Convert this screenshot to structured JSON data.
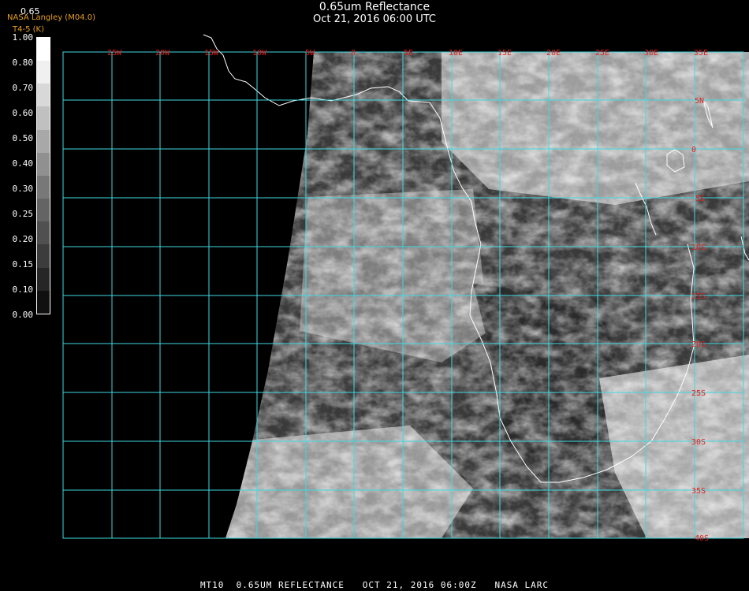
{
  "header": {
    "title": "0.65um Reflectance",
    "subtitle": "Oct 21, 2016 06:00 UTC",
    "credit": "NASA Langley (M04.0)",
    "credit2": "T4-5 (K)",
    "value_label": "0.65"
  },
  "colorbar": {
    "ticks": [
      "1.00",
      "0.80",
      "0.70",
      "0.60",
      "0.50",
      "0.40",
      "0.30",
      "0.25",
      "0.20",
      "0.15",
      "0.10",
      "0.00"
    ],
    "colors": [
      "#ffffff",
      "#f0f0f0",
      "#d8d8d8",
      "#c0c0c0",
      "#a8a8a8",
      "#909090",
      "#787878",
      "#646464",
      "#505050",
      "#3c3c3c",
      "#262626",
      "#101010"
    ]
  },
  "map": {
    "longitude_labels": [
      "25W",
      "20W",
      "15W",
      "10W",
      "5W",
      "0",
      "5E",
      "10E",
      "15E",
      "20E",
      "25E",
      "30E",
      "35E"
    ],
    "latitude_labels": [
      "5N",
      "0",
      "5S",
      "10S",
      "15S",
      "20S",
      "25S",
      "30S",
      "35S",
      "40S"
    ],
    "grid_color": "#40d8e0",
    "label_color": "#e02020",
    "coast_color": "#ffffff"
  },
  "footer": {
    "text": "MT10  0.65UM REFLECTANCE   OCT 21, 2016 06:00Z   NASA LARC"
  }
}
